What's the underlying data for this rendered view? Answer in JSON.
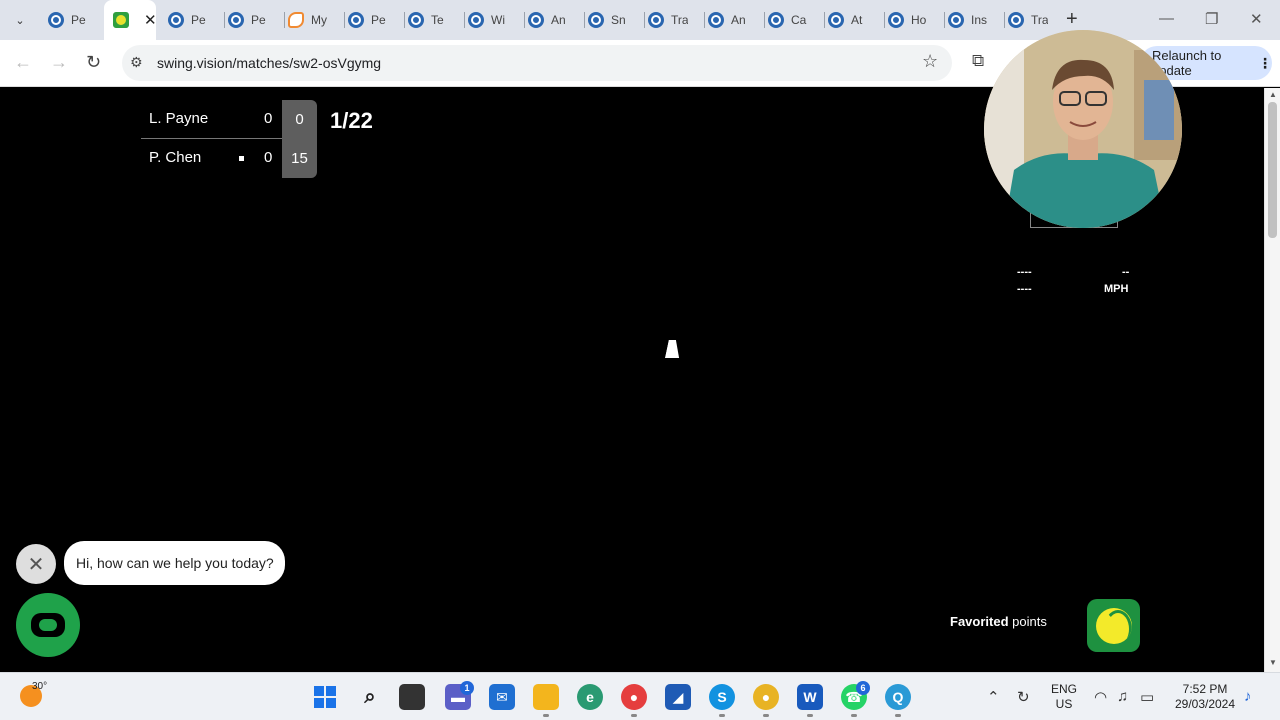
{
  "browser": {
    "tabs": [
      {
        "title": "Pe",
        "icon": "wordpress-icon"
      },
      {
        "title": "",
        "icon": "swingvision-icon",
        "active": true
      },
      {
        "title": "Pe",
        "icon": "wordpress-icon"
      },
      {
        "title": "Pe",
        "icon": "wordpress-icon"
      },
      {
        "title": "My",
        "icon": "orange-app-icon"
      },
      {
        "title": "Pe",
        "icon": "wordpress-icon"
      },
      {
        "title": "Te",
        "icon": "wordpress-icon"
      },
      {
        "title": "Wi",
        "icon": "wordpress-icon"
      },
      {
        "title": "An",
        "icon": "wordpress-icon"
      },
      {
        "title": "Sn",
        "icon": "wordpress-icon"
      },
      {
        "title": "Tra",
        "icon": "wordpress-icon"
      },
      {
        "title": "An",
        "icon": "wordpress-icon"
      },
      {
        "title": "Ca",
        "icon": "wordpress-icon"
      },
      {
        "title": "At",
        "icon": "wordpress-icon"
      },
      {
        "title": "Ho",
        "icon": "wordpress-icon"
      },
      {
        "title": "Ins",
        "icon": "wordpress-icon"
      },
      {
        "title": "Tra",
        "icon": "wordpress-icon"
      }
    ],
    "url": "swing.vision/matches/sw2-osVgymg",
    "update_button": "Relaunch to update"
  },
  "match": {
    "players": [
      {
        "name": "L. Payne",
        "games": "0",
        "points": "0",
        "serving": false
      },
      {
        "name": "P. Chen",
        "games": "0",
        "points": "15",
        "serving": true
      }
    ],
    "point_counter": "1/22",
    "speed": {
      "left_top": "----",
      "left_bottom": "----",
      "right_top": "--",
      "unit": "MPH"
    }
  },
  "chat": {
    "greeting": "Hi, how can we help you today?"
  },
  "favorites": {
    "bold": "Favorited",
    "rest": " points"
  },
  "taskbar": {
    "temperature": "30°",
    "lang_top": "ENG",
    "lang_bottom": "US",
    "time": "7:52 PM",
    "date": "29/03/2024",
    "teams_badge": "1",
    "whatsapp_badge": "6"
  },
  "colors": {
    "accent_green": "#1fa24a",
    "ball_yellow": "#f3ea2a"
  }
}
